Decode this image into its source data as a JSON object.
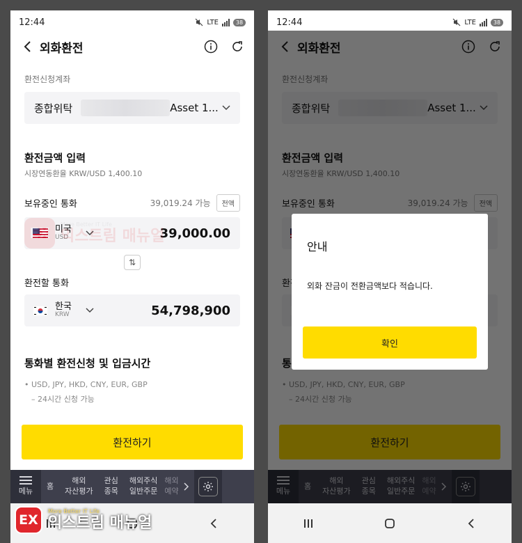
{
  "status": {
    "time": "12:44",
    "network": "LTE",
    "battery": "38"
  },
  "appbar": {
    "title": "외화환전"
  },
  "account": {
    "label": "환전신청계좌",
    "type": "종합위탁",
    "name": "Asset 1..."
  },
  "exchange": {
    "title": "환전금액 입력",
    "rate": "시장연동환율  KRW/USD  1,400.10",
    "holding_label": "보유중인 통화",
    "available": "39,019.24 가능",
    "all_button": "전액",
    "from": {
      "country": "미국",
      "code": "USD",
      "amount": "39,000.00"
    },
    "target_label": "환전할 통화",
    "to": {
      "country": "한국",
      "code": "KRW",
      "amount": "54,798,900"
    }
  },
  "schedule": {
    "title": "통화별 환전신청 및 입금시간",
    "currencies": "• USD, JPY, HKD, CNY, EUR, GBP",
    "note": "– 24시간 신청 가능"
  },
  "cta": {
    "label": "환전하기"
  },
  "bottom_tabs": {
    "menu": "메뉴",
    "home": "홈",
    "overseas_eval_1": "해외",
    "overseas_eval_2": "자산평가",
    "watch_1": "관심",
    "watch_2": "종목",
    "order_1": "해외주식",
    "order_2": "일반주문",
    "cut_1": "해외",
    "cut_2": "예약"
  },
  "dialog": {
    "title": "안내",
    "message": "외화 잔금이 전환금액보다 적습니다.",
    "confirm": "확인"
  },
  "watermark": {
    "tagline": "More Better IT Life",
    "name": "익스트림 매뉴얼",
    "logo": "EX"
  },
  "colors": {
    "accent": "#ffdc00",
    "tabbar": "#3e3f4c",
    "brand": "#e0262c"
  }
}
